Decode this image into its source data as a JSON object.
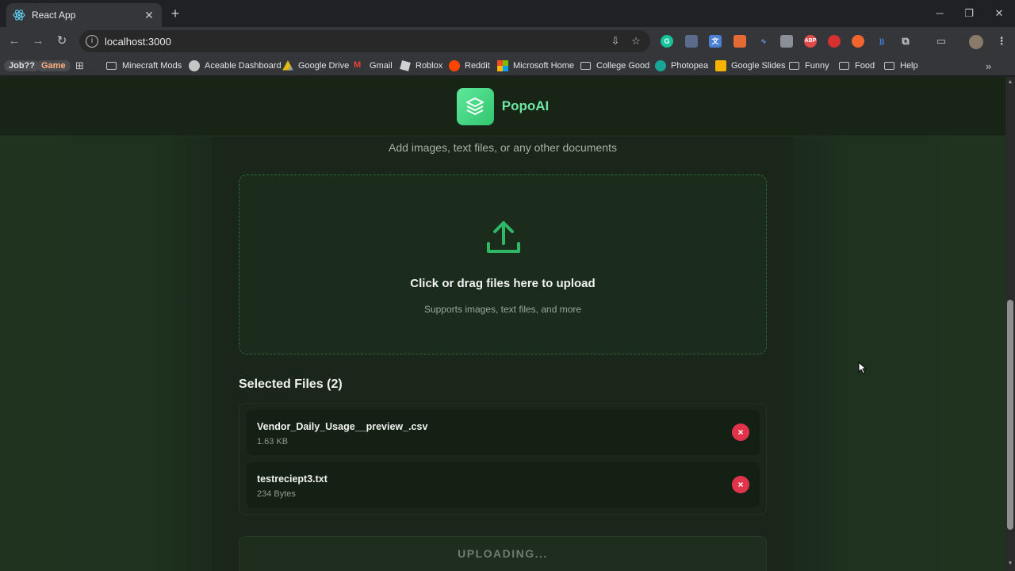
{
  "browser": {
    "tab_title": "React App",
    "new_tab": "+",
    "url": "localhost:3000",
    "bookmarks": [
      {
        "label": "Job??",
        "type": "chip"
      },
      {
        "label": "Game",
        "type": "chip"
      },
      {
        "label": "Minecraft Mods",
        "type": "folder"
      },
      {
        "label": "Aceable Dashboard",
        "type": "site"
      },
      {
        "label": "Google Drive",
        "type": "site"
      },
      {
        "label": "Gmail",
        "type": "site"
      },
      {
        "label": "Roblox",
        "type": "site"
      },
      {
        "label": "Reddit",
        "type": "site"
      },
      {
        "label": "Microsoft Home",
        "type": "site"
      },
      {
        "label": "College Good",
        "type": "folder"
      },
      {
        "label": "Photopea",
        "type": "site"
      },
      {
        "label": "Google Slides",
        "type": "site"
      },
      {
        "label": "Funny",
        "type": "folder"
      },
      {
        "label": "Food",
        "type": "folder"
      },
      {
        "label": "Help",
        "type": "folder"
      }
    ]
  },
  "app": {
    "brand": "PopoAI",
    "subtitle": "Add images, text files, or any other documents",
    "dropzone": {
      "title": "Click or drag files here to upload",
      "subtitle": "Supports images, text files, and more",
      "icon": "upload-icon"
    },
    "selected_heading": "Selected Files (2)",
    "files": [
      {
        "name": "Vendor_Daily_Usage__preview_.csv",
        "size": "1.63 KB",
        "remove": "×"
      },
      {
        "name": "testreciept3.txt",
        "size": "234 Bytes",
        "remove": "×"
      }
    ],
    "upload_button": "UPLOADING..."
  },
  "colors": {
    "accent": "#4ade80",
    "brand_text": "#6ee7a2",
    "danger": "#e0344b",
    "background": "#1d2b1d"
  }
}
